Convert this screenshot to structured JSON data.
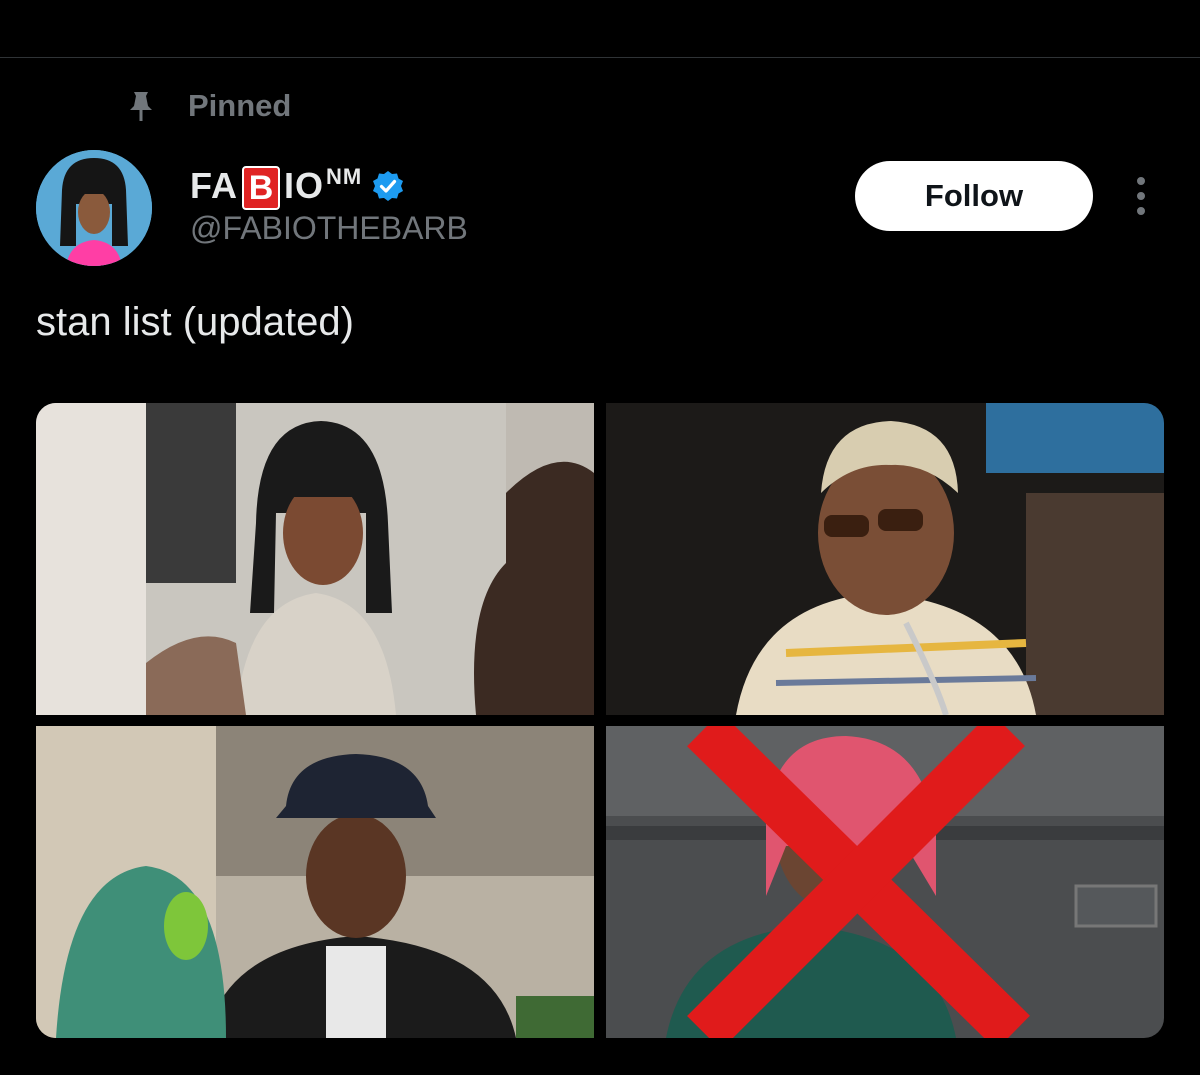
{
  "pinned": {
    "label": "Pinned",
    "icon": "pin-icon"
  },
  "user": {
    "name_prefix": "FA",
    "name_badge_letter": "B",
    "name_suffix": "IO",
    "name_superscript": "NM",
    "handle": "@FABIOTHEBARB",
    "verified": true,
    "verified_color": "#1d9bf0"
  },
  "actions": {
    "follow_label": "Follow",
    "more_icon": "more-vertical-icon"
  },
  "tweet": {
    "text": "stan list (updated)"
  },
  "media_count": 4,
  "colors": {
    "background": "#000000",
    "primary_text": "#e7e9ea",
    "secondary_text": "#71767b",
    "badge_red": "#e02424",
    "cross_red": "#e01b1b"
  }
}
